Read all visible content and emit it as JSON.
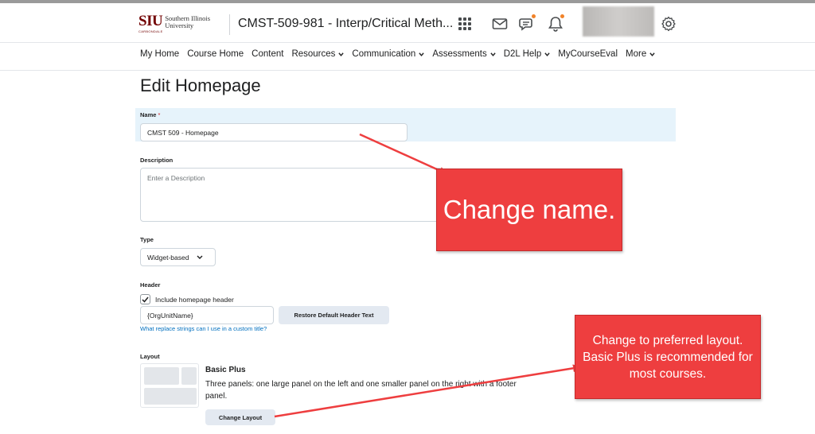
{
  "header": {
    "logo_siu": "SIU",
    "logo_name_line1": "Southern Illinois",
    "logo_name_line2": "University",
    "logo_sub": "CARBONDALE",
    "course_title": "CMST-509-981 - Interp/Critical Meth...",
    "icons": [
      "grid-icon",
      "mail-icon",
      "chat-icon",
      "bell-icon",
      "gear-icon"
    ],
    "notification_color": "#f18329"
  },
  "nav": {
    "items": [
      {
        "label": "My Home",
        "dropdown": false
      },
      {
        "label": "Course Home",
        "dropdown": false
      },
      {
        "label": "Content",
        "dropdown": false
      },
      {
        "label": "Resources",
        "dropdown": true
      },
      {
        "label": "Communication",
        "dropdown": true
      },
      {
        "label": "Assessments",
        "dropdown": true
      },
      {
        "label": "D2L Help",
        "dropdown": true
      },
      {
        "label": "MyCourseEval",
        "dropdown": false
      },
      {
        "label": "More",
        "dropdown": true
      }
    ]
  },
  "form": {
    "page_title": "Edit Homepage",
    "name_label": "Name",
    "name_required": "*",
    "name_value": "CMST 509 - Homepage",
    "description_label": "Description",
    "description_placeholder": "Enter a Description",
    "type_label": "Type",
    "type_value": "Widget-based",
    "header_label": "Header",
    "include_header_label": "Include homepage header",
    "include_header_checked": true,
    "header_text_value": "{OrgUnitName}",
    "restore_button": "Restore Default Header Text",
    "replace_strings_link": "What replace strings can I use in a custom title?",
    "layout_label": "Layout",
    "layout_name": "Basic Plus",
    "layout_description": "Three panels: one large panel on the left and one smaller panel on the right with a footer panel.",
    "change_layout_button": "Change Layout"
  },
  "annotations": {
    "callout_name": "Change name.",
    "callout_layout": "Change to preferred layout. Basic Plus is recommended for most courses.",
    "color": "#ee3e3f"
  }
}
